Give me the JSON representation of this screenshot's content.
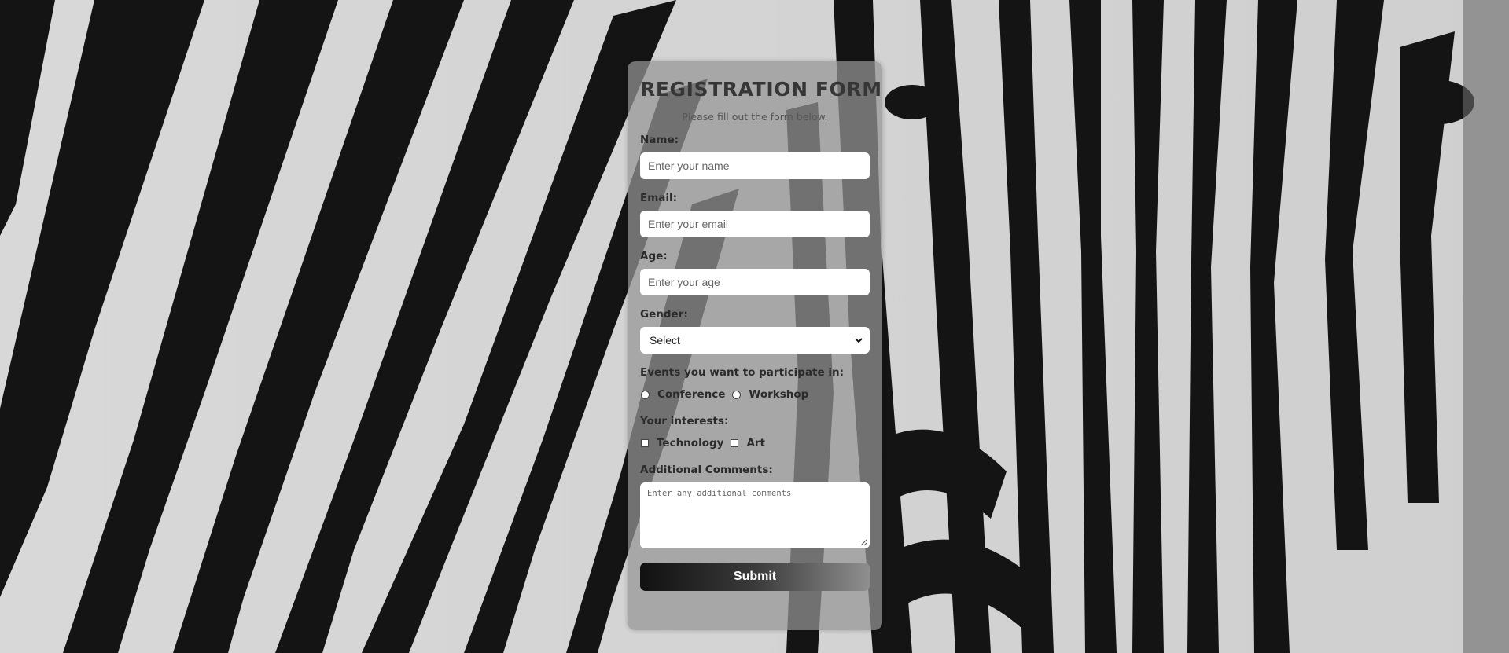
{
  "form": {
    "title": "REGISTRATION FORM",
    "subtitle": "Please fill out the form below.",
    "name": {
      "label": "Name:",
      "placeholder": "Enter your name",
      "value": ""
    },
    "email": {
      "label": "Email:",
      "placeholder": "Enter your email",
      "value": ""
    },
    "age": {
      "label": "Age:",
      "placeholder": "Enter your age",
      "value": ""
    },
    "gender": {
      "label": "Gender:",
      "selected": "Select"
    },
    "events": {
      "label": "Events you want to participate in:",
      "options": [
        "Conference",
        "Workshop"
      ]
    },
    "interests": {
      "label": "Your interests:",
      "options": [
        "Technology",
        "Art"
      ]
    },
    "comments": {
      "label": "Additional Comments:",
      "placeholder": "Enter any additional comments"
    },
    "submit_label": "Submit"
  },
  "icons": {
    "select_arrow": "chevron-down-icon",
    "textarea_resize": "resize-grip-icon",
    "background": "zebra-background-image"
  },
  "colors": {
    "card_background": "#969696",
    "title": "#363636",
    "button_start": "#111111",
    "button_end": "#8f8f8f"
  }
}
